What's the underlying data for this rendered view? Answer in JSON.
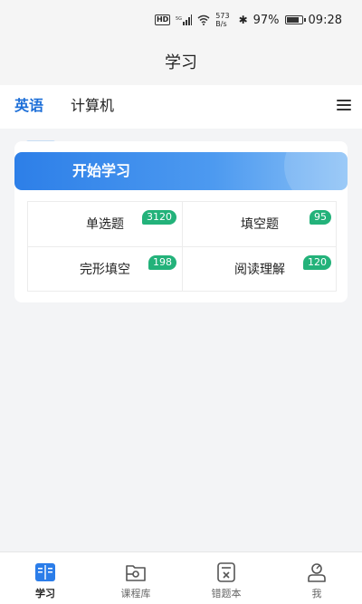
{
  "status_bar": {
    "hd": "HD",
    "net_speed": "573",
    "net_unit": "B/s",
    "battery": "97%",
    "battery_level": 0.97,
    "time": "09:28"
  },
  "header": {
    "title": "学习"
  },
  "tabs": [
    {
      "label": "英语",
      "active": true
    },
    {
      "label": "计算机",
      "active": false
    }
  ],
  "banner": {
    "title": "开始学习"
  },
  "categories": [
    {
      "label": "单选题",
      "count": "3120"
    },
    {
      "label": "填空题",
      "count": "95"
    },
    {
      "label": "完形填空",
      "count": "198"
    },
    {
      "label": "阅读理解",
      "count": "120"
    }
  ],
  "bottom_nav": [
    {
      "label": "学习",
      "icon": "book-icon",
      "active": true
    },
    {
      "label": "课程库",
      "icon": "folder-icon",
      "active": false
    },
    {
      "label": "错题本",
      "icon": "wrong-book-icon",
      "active": false
    },
    {
      "label": "我",
      "icon": "profile-icon",
      "active": false
    }
  ],
  "colors": {
    "accent": "#1d6fd8",
    "badge": "#23b27a",
    "banner_start": "#2d7fe8",
    "banner_end": "#8bc1f6"
  }
}
